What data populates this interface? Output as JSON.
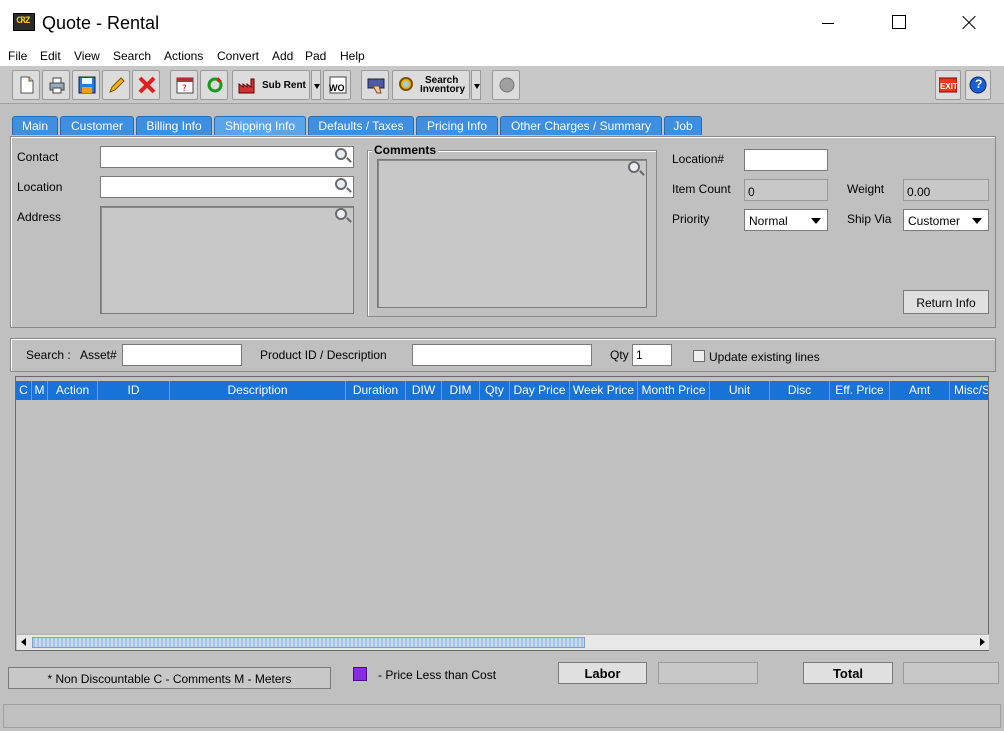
{
  "window": {
    "title": "Quote - Rental",
    "logo_text": "CRZ"
  },
  "menu": [
    "File",
    "Edit",
    "View",
    "Search",
    "Actions",
    "Convert",
    "Add",
    "Pad",
    "Help"
  ],
  "toolbar": {
    "sub_rent_label": "Sub Rent",
    "wo_label": "WO",
    "search_label_1": "Search",
    "search_label_2": "Inventory",
    "exit_label": "EXIT",
    "help_label": "?"
  },
  "tabs": [
    "Main",
    "Customer",
    "Billing Info",
    "Shipping Info",
    "Defaults / Taxes",
    "Pricing Info",
    "Other Charges / Summary",
    "Job"
  ],
  "shipping": {
    "contact_label": "Contact",
    "location_label": "Location",
    "address_label": "Address",
    "comments_label": "Comments",
    "location_no_label": "Location#",
    "location_no_value": "",
    "item_count_label": "Item Count",
    "item_count_value": "0",
    "weight_label": "Weight",
    "weight_value": "0.00",
    "priority_label": "Priority",
    "priority_value": "Normal",
    "ship_via_label": "Ship Via",
    "ship_via_value": "Customer",
    "return_info_label": "Return Info"
  },
  "search": {
    "label": "Search :",
    "asset_label": "Asset#",
    "product_label": "Product ID / Description",
    "qty_label": "Qty",
    "qty_value": "1",
    "update_label": "Update existing lines"
  },
  "grid": {
    "columns": [
      "C",
      "M",
      "Action",
      "ID",
      "Description",
      "Duration",
      "DIW",
      "DIM",
      "Qty",
      "Day Price",
      "Week Price",
      "Month Price",
      "Unit",
      "Disc",
      "Eff. Price",
      "Amt",
      "Misc/S"
    ]
  },
  "footer": {
    "legend_text": "* Non Discountable   C - Comments    M - Meters",
    "price_less_text": "- Price Less than Cost",
    "labor_label": "Labor",
    "labor_value": "",
    "total_label": "Total",
    "total_value": ""
  },
  "colors": {
    "tab_blue": "#3f8fe0",
    "header_blue": "#1873d8",
    "legend_purple": "#8a2be2",
    "panel_gray": "#c0c0c0"
  }
}
